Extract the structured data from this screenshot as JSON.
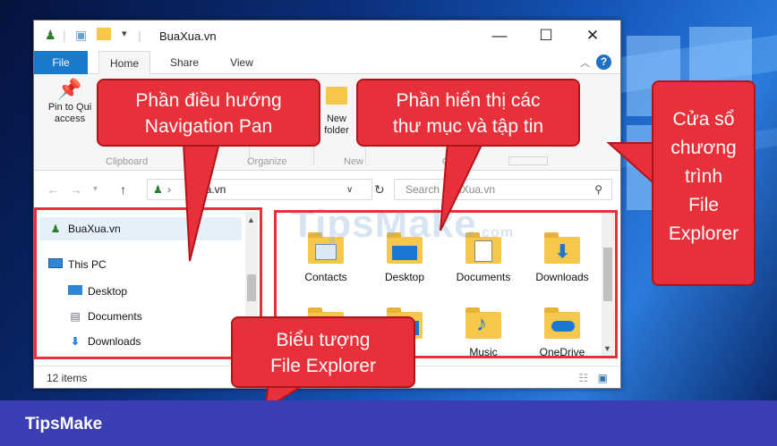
{
  "window": {
    "title": "BuaXua.vn",
    "minimize": "—",
    "maximize": "☐",
    "close": "✕"
  },
  "tabs": [
    "File",
    "Home",
    "Share",
    "View"
  ],
  "ribbon": {
    "pin_label_1": "Pin to Qui",
    "pin_label_2": "access",
    "new_folder_1": "New",
    "new_folder_2": "folder",
    "group_clipboard": "Clipboard",
    "group_organize": "Organize",
    "group_new": "New",
    "group_open": "O"
  },
  "address": {
    "path": "Xua.vn",
    "search_placeholder": "Search BuaXua.vn"
  },
  "nav_pane": {
    "items": [
      {
        "label": "BuaXua.vn",
        "icon": "user-folder-icon"
      },
      {
        "label": "This PC",
        "icon": "pc-icon"
      },
      {
        "label": "Desktop",
        "icon": "desktop-icon"
      },
      {
        "label": "Documents",
        "icon": "documents-icon"
      },
      {
        "label": "Downloads",
        "icon": "download-icon"
      }
    ]
  },
  "files": {
    "items": [
      {
        "label": "Contacts",
        "icon": "contacts-icon"
      },
      {
        "label": "Desktop",
        "icon": "desktop-folder-icon"
      },
      {
        "label": "Documents",
        "icon": "documents-folder-icon"
      },
      {
        "label": "Downloads",
        "icon": "downloads-folder-icon"
      },
      {
        "label": "",
        "icon": "folder-icon"
      },
      {
        "label": "",
        "icon": "folder-icon"
      },
      {
        "label": "Music",
        "icon": "music-folder-icon"
      },
      {
        "label": "OneDrive",
        "icon": "onedrive-folder-icon"
      }
    ]
  },
  "status": {
    "count": "12 items"
  },
  "annotations": {
    "nav_callout_1": "Phần điều hướng",
    "nav_callout_2": "Navigation Pan",
    "content_callout_1": "Phần hiển thị các",
    "content_callout_2": "thư mục và tập tin",
    "window_callout_1": "Cửa sổ",
    "window_callout_2": "chương",
    "window_callout_3": "trình",
    "window_callout_4": "File",
    "window_callout_5": "Explorer",
    "icon_callout_1": "Biểu tượng",
    "icon_callout_2": "File Explorer"
  },
  "watermark": "TipsMake",
  "watermark_suffix": ".com",
  "footer": {
    "brand": "TipsMake"
  },
  "colors": {
    "callout_red": "#e8303a",
    "footer_blue": "#3b3fb3",
    "file_tab_blue": "#1979ca"
  }
}
